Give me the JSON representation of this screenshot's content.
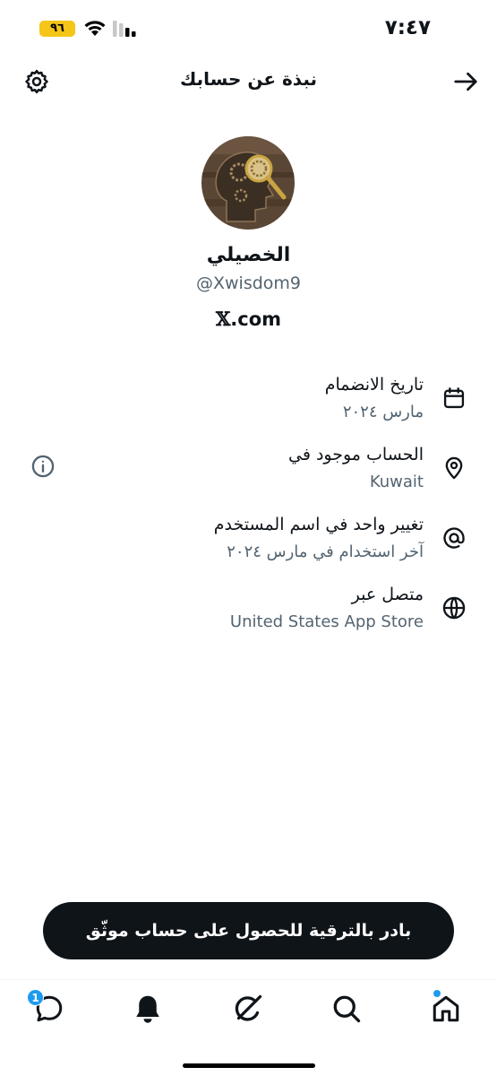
{
  "status_bar": {
    "time": "٧:٤٧",
    "battery": "٩٦"
  },
  "header": {
    "title": "نبذة عن حسابك"
  },
  "profile": {
    "name": "الخصيلي",
    "handle": "@Xwisdom9",
    "domain_logo": "𝕏",
    "domain_suffix": ".com"
  },
  "info": [
    {
      "icon": "calendar-icon",
      "title": "تاريخ الانضمام",
      "value": "مارس ٢٠٢٤"
    },
    {
      "icon": "location-pin-icon",
      "title": "الحساب موجود في",
      "value": "Kuwait"
    },
    {
      "icon": "at-sign-icon",
      "title": "تغيير واحد في اسم المستخدم",
      "value": "آخر استخدام في مارس ٢٠٢٤"
    },
    {
      "icon": "globe-icon",
      "title": "متصل عبر",
      "value": "United States App Store"
    }
  ],
  "verify_button": {
    "label": "بادر بالترقية للحصول على حساب موثّق"
  },
  "tabs": [
    {
      "name": "home",
      "icon": "home-icon"
    },
    {
      "name": "search",
      "icon": "search-icon"
    },
    {
      "name": "grok",
      "icon": "grok-icon"
    },
    {
      "name": "notifications",
      "icon": "bell-icon"
    },
    {
      "name": "messages",
      "icon": "message-icon",
      "badge": "1"
    }
  ],
  "colors": {
    "accent": "#1d9bf0",
    "text": "#0f1419",
    "muted": "#536471",
    "button_bg": "#0f1419"
  }
}
